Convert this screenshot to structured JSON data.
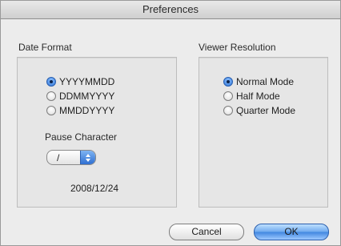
{
  "window": {
    "title": "Preferences"
  },
  "date_format": {
    "heading": "Date Format",
    "options": [
      {
        "label": "YYYYMMDD",
        "selected": true
      },
      {
        "label": "DDMMYYYY",
        "selected": false
      },
      {
        "label": "MMDDYYYY",
        "selected": false
      }
    ],
    "pause_label": "Pause Character",
    "pause_value": "/",
    "preview": "2008/12/24"
  },
  "viewer_resolution": {
    "heading": "Viewer Resolution",
    "options": [
      {
        "label": "Normal Mode",
        "selected": true
      },
      {
        "label": "Half Mode",
        "selected": false
      },
      {
        "label": "Quarter Mode",
        "selected": false
      }
    ]
  },
  "buttons": {
    "cancel": "Cancel",
    "ok": "OK"
  },
  "colors": {
    "accent": "#2d74d6",
    "background": "#ececec"
  }
}
